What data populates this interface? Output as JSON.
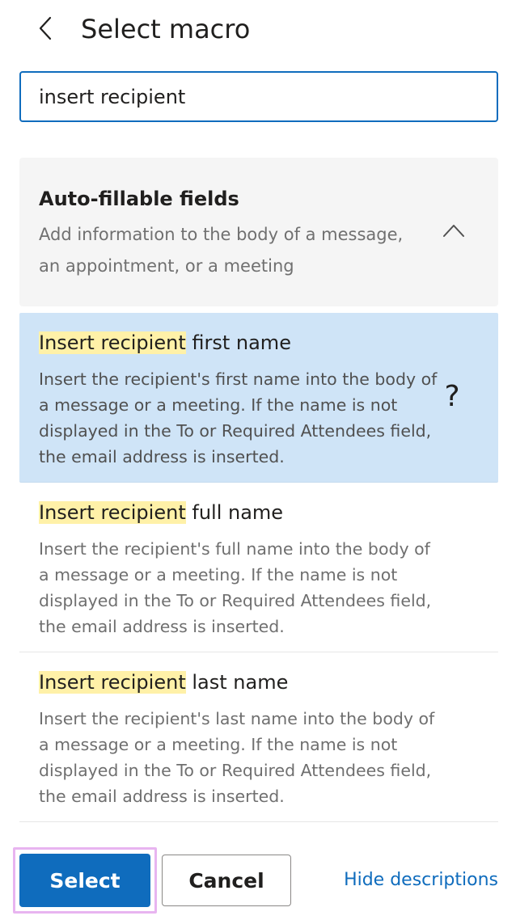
{
  "header": {
    "back_icon": "chevron-left-icon",
    "title": "Select macro"
  },
  "search": {
    "value": "insert recipient",
    "placeholder": ""
  },
  "group": {
    "title": "Auto-fillable fields",
    "description": "Add information to the body of a message, an appointment, or a meeting",
    "expand_icon": "chevron-up-icon"
  },
  "items": [
    {
      "highlight": "Insert recipient",
      "rest": " first name",
      "description": "Insert the recipient's first name into the body of a message or a meeting. If the name is not displayed in the To or Required Attendees field, the email address is inserted.",
      "help": "?"
    },
    {
      "highlight": "Insert recipient",
      "rest": " full name",
      "description": "Insert the recipient's full name into the body of a message or a meeting. If the name is not displayed in the To or Required Attendees field, the email address is inserted."
    },
    {
      "highlight": "Insert recipient",
      "rest": " last name",
      "description": "Insert the recipient's last name into the body of a message or a meeting. If the name is not displayed in the To or Required Attendees field, the email address is inserted."
    }
  ],
  "footer": {
    "select_label": "Select",
    "cancel_label": "Cancel",
    "hide_descriptions_label": "Hide descriptions"
  },
  "colors": {
    "accent": "#0f6cbd",
    "selected_bg": "#cfe4f7",
    "highlight": "#fff1a8",
    "group_bg": "#f5f5f5"
  }
}
